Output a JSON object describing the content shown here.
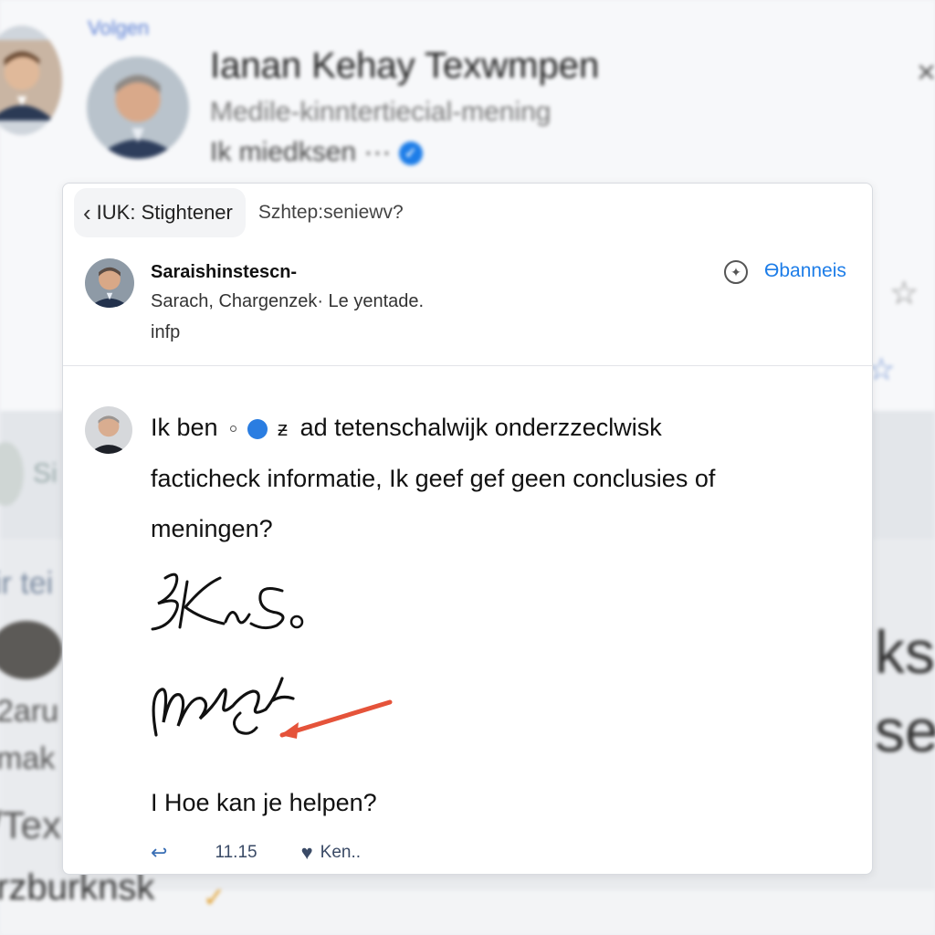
{
  "background": {
    "link_top": "Volgen",
    "name": "Ianan Kehay Texwmpen",
    "subtitle": "Medile-kinntertiecial-mening",
    "handle": "Ik miedksen ···",
    "left_fragment_1": "Si",
    "left_fragment_2": "ir tei",
    "left_fragment_3": "2aru",
    "left_fragment_4": "mak",
    "left_fragment_5": "/Tex",
    "bottom_text": "rzburknsk",
    "right_fragment_1": "ks",
    "right_fragment_2": "se",
    "verified_icon": "checkmark-badge-icon",
    "star_icon": "star-icon",
    "close_icon": "close-icon"
  },
  "card": {
    "back_label": "IUK: Stightener",
    "tab_label": "Szhtep:seniewv?",
    "profile": {
      "name": "Saraishinstescn-",
      "subtitle": "Sarach, Chargenzek· Le yentade.",
      "info": "infp",
      "action_label": "Ɵbanneis"
    },
    "message": {
      "line1_a": "Ik ben",
      "line1_b": "ad tetenschalwijk onderzzeclwisk",
      "line2": "facticheck informatie, Ik geef gef geen conclusies of",
      "line3": "meningen?"
    },
    "question": "I Hoe kan je helpen?",
    "footer": {
      "count": "11.15",
      "like_label": "Ken.."
    }
  },
  "colors": {
    "accent": "#1d7de8",
    "arrow": "#e5533a"
  }
}
